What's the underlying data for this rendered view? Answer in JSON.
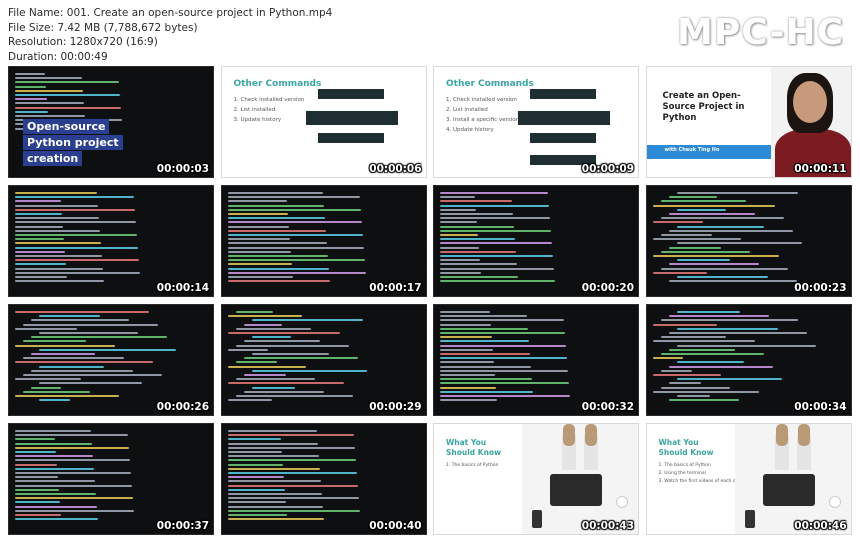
{
  "header": {
    "file_name": "File Name: 001. Create an open-source project in Python.mp4",
    "file_size": "File Size: 7.42 MB (7,788,672 bytes)",
    "resolution": "Resolution: 1280x720 (16:9)",
    "duration": "Duration: 00:00:49"
  },
  "logo": "MPC-HC",
  "thumbnails": [
    {
      "time": "00:00:03",
      "kind": "intro-terminal",
      "overlay": [
        "Open-source",
        "Python project",
        "creation"
      ]
    },
    {
      "time": "00:00:06",
      "kind": "slide",
      "title": "Other Commands",
      "items": [
        "Check installed version",
        "List installed",
        "Update history"
      ]
    },
    {
      "time": "00:00:09",
      "kind": "slide",
      "title": "Other Commands",
      "items": [
        "Check installed version",
        "List installed",
        "Install a specific version",
        "Update history"
      ]
    },
    {
      "time": "00:00:11",
      "kind": "course",
      "title": "Create an Open-Source Project in Python",
      "author": "with Cheuk Ting Ho"
    },
    {
      "time": "00:00:14",
      "kind": "terminal"
    },
    {
      "time": "00:00:17",
      "kind": "terminal"
    },
    {
      "time": "00:00:20",
      "kind": "terminal"
    },
    {
      "time": "00:00:23",
      "kind": "code"
    },
    {
      "time": "00:00:26",
      "kind": "code"
    },
    {
      "time": "00:00:29",
      "kind": "code"
    },
    {
      "time": "00:00:32",
      "kind": "terminal"
    },
    {
      "time": "00:00:34",
      "kind": "code"
    },
    {
      "time": "00:00:37",
      "kind": "terminal"
    },
    {
      "time": "00:00:40",
      "kind": "terminal"
    },
    {
      "time": "00:00:43",
      "kind": "wyk",
      "title": "What You Should Know",
      "items": [
        "The basics of Python"
      ]
    },
    {
      "time": "00:00:46",
      "kind": "wyk",
      "title": "What You Should Know",
      "items": [
        "The basics of Python",
        "Using the terminal",
        "Watch the first videos of each chapter"
      ]
    }
  ]
}
